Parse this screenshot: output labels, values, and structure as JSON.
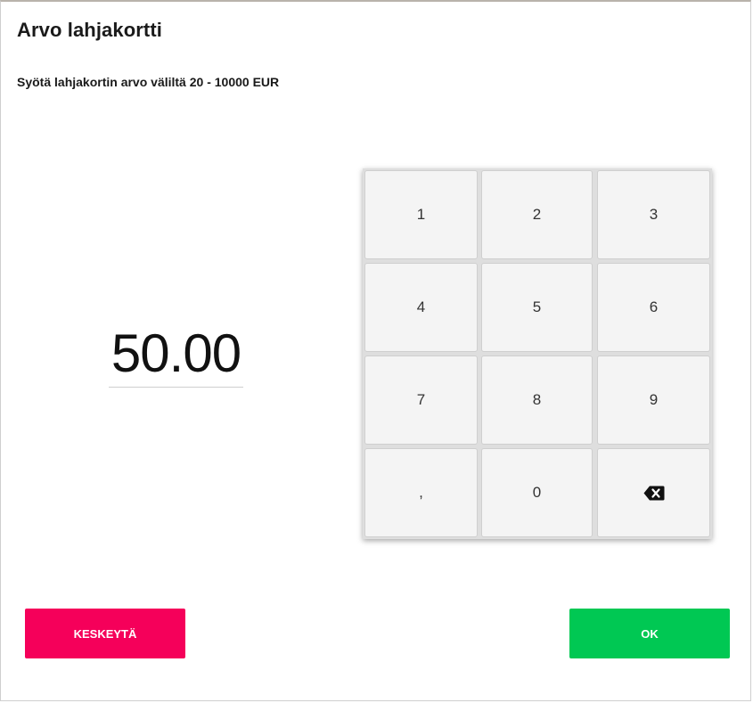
{
  "dialog": {
    "title": "Arvo lahjakortti",
    "subtitle": "Syötä lahjakortin arvo väliltä 20 - 10000 EUR",
    "amount": "50.00"
  },
  "keypad": {
    "keys": [
      "1",
      "2",
      "3",
      "4",
      "5",
      "6",
      "7",
      "8",
      "9",
      ",",
      "0"
    ],
    "backspace_icon": "backspace-icon"
  },
  "buttons": {
    "cancel_label": "KESKEYTÄ",
    "ok_label": "OK"
  },
  "colors": {
    "cancel": "#f5005a",
    "ok": "#00c853",
    "key_bg": "#f4f4f4"
  }
}
